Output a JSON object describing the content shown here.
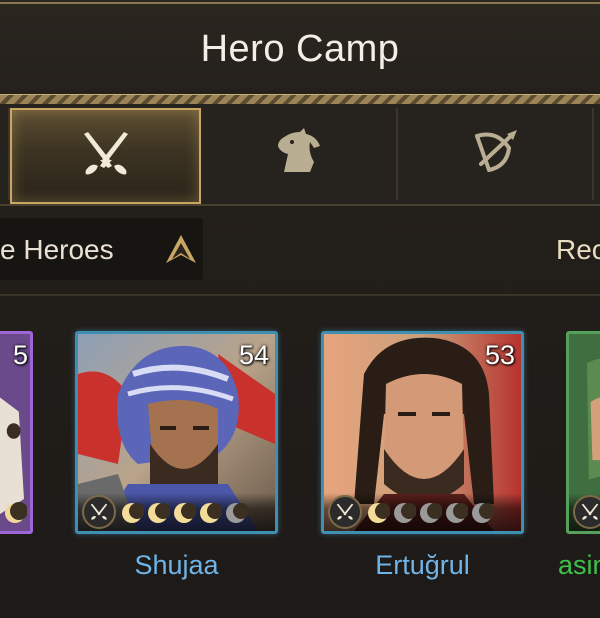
{
  "header": {
    "title": "Hero Camp"
  },
  "tabs": [
    {
      "label": "",
      "icon": "crossed-swords-icon",
      "active": true
    },
    {
      "label": "",
      "icon": "horse-head-icon",
      "active": false
    },
    {
      "label": "",
      "icon": "bow-arrow-icon",
      "active": false
    }
  ],
  "filter": {
    "label": "e Heroes",
    "sort_icon": "sort-arrow-icon"
  },
  "right_label": "Rec",
  "heroes": [
    {
      "name": "",
      "level": "5",
      "rarity_color": "#9d66d6",
      "stars": 1,
      "max_stars": 1
    },
    {
      "name": "Shujaa",
      "level": "54",
      "rarity_color": "#3f8fb3",
      "stars": 4,
      "max_stars": 5,
      "class_icon": "crossed-swords-icon"
    },
    {
      "name": "Ertuğrul",
      "level": "53",
      "rarity_color": "#3f8fb3",
      "stars": 1,
      "max_stars": 5,
      "class_icon": "crossed-swords-icon"
    },
    {
      "name": "asin",
      "level": "",
      "rarity_color": "#56a05b",
      "stars": 0,
      "max_stars": 0,
      "class_icon": "crossed-swords-icon"
    }
  ],
  "colors": {
    "name_blue": "#6fb4e8",
    "name_green": "#3ec24a",
    "gold": "#c9a664"
  }
}
